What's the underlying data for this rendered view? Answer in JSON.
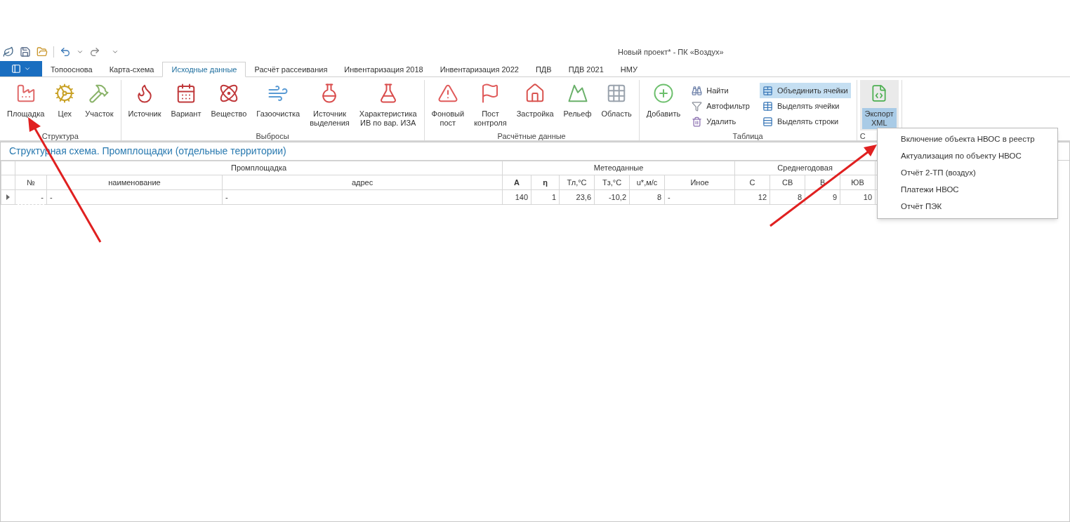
{
  "window": {
    "title": "Новый проект* - ПК «Воздух»"
  },
  "tabs": [
    {
      "label": "Топооснова",
      "selected": false
    },
    {
      "label": "Карта-схема",
      "selected": false
    },
    {
      "label": "Исходные данные",
      "selected": true
    },
    {
      "label": "Расчёт рассеивания",
      "selected": false
    },
    {
      "label": "Инвентаризация 2018",
      "selected": false
    },
    {
      "label": "Инвентаризация 2022",
      "selected": false
    },
    {
      "label": "ПДВ",
      "selected": false
    },
    {
      "label": "ПДВ 2021",
      "selected": false
    },
    {
      "label": "НМУ",
      "selected": false
    }
  ],
  "ribbon": {
    "groups": [
      {
        "label": "Структура",
        "items": [
          {
            "kind": "large",
            "label": "Площадка"
          },
          {
            "kind": "large",
            "label": "Цех"
          },
          {
            "kind": "large",
            "label": "Участок"
          }
        ]
      },
      {
        "label": "Выбросы",
        "items": [
          {
            "kind": "large",
            "label": "Источник"
          },
          {
            "kind": "large",
            "label": "Вариант"
          },
          {
            "kind": "large",
            "label": "Вещество"
          },
          {
            "kind": "large",
            "label": "Газоочистка"
          },
          {
            "kind": "large",
            "label": "Источник\nвыделения"
          },
          {
            "kind": "large",
            "label": "Характеристика\nИВ по вар. ИЗА"
          }
        ]
      },
      {
        "label": "Расчётные данные",
        "items": [
          {
            "kind": "large",
            "label": "Фоновый\nпост"
          },
          {
            "kind": "large",
            "label": "Пост\nконтроля"
          },
          {
            "kind": "large",
            "label": "Застройка"
          },
          {
            "kind": "large",
            "label": "Рельеф"
          },
          {
            "kind": "large",
            "label": "Область"
          }
        ]
      },
      {
        "label": "Таблица",
        "items": [
          {
            "kind": "large",
            "label": "Добавить"
          },
          {
            "kind": "small",
            "label": "Найти"
          },
          {
            "kind": "small",
            "label": "Автофильтр"
          },
          {
            "kind": "small",
            "label": "Удалить"
          },
          {
            "kind": "small",
            "label": "Объединить ячейки",
            "selected": true
          },
          {
            "kind": "small",
            "label": "Выделять ячейки",
            "selected": false
          },
          {
            "kind": "small",
            "label": "Выделять строки",
            "selected": false
          }
        ]
      },
      {
        "label": "С",
        "items": [
          {
            "kind": "menu",
            "label": "Экспорт\nXML",
            "expanded": true
          }
        ]
      }
    ]
  },
  "panel": {
    "title": "Структурная схема. Промплощадки (отдельные территории)"
  },
  "table": {
    "groups": [
      {
        "label": "Промплощадка",
        "columns": [
          "№",
          "наименование",
          "адрес"
        ]
      },
      {
        "label": "Метеоданные",
        "columns": [
          "А",
          "η",
          "Тл,°С",
          "Тз,°С",
          "u*,м/с",
          "Иное"
        ]
      },
      {
        "label": "Среднегодовая",
        "columns": [
          "С",
          "СВ",
          "В",
          "ЮВ"
        ]
      }
    ],
    "rows": [
      {
        "selected": true,
        "cells": [
          "-",
          "-",
          "-",
          "140",
          "1",
          "23,6",
          "-10,2",
          "8",
          "-",
          "12",
          "8",
          "9",
          "10"
        ]
      }
    ]
  },
  "menu": {
    "items": [
      "Включение объекта НВОС в реестр",
      "Актуализация по объекту НВОС",
      "Отчёт 2-ТП (воздух)",
      "Платежи НВОС",
      "Отчёт ПЭК"
    ]
  }
}
